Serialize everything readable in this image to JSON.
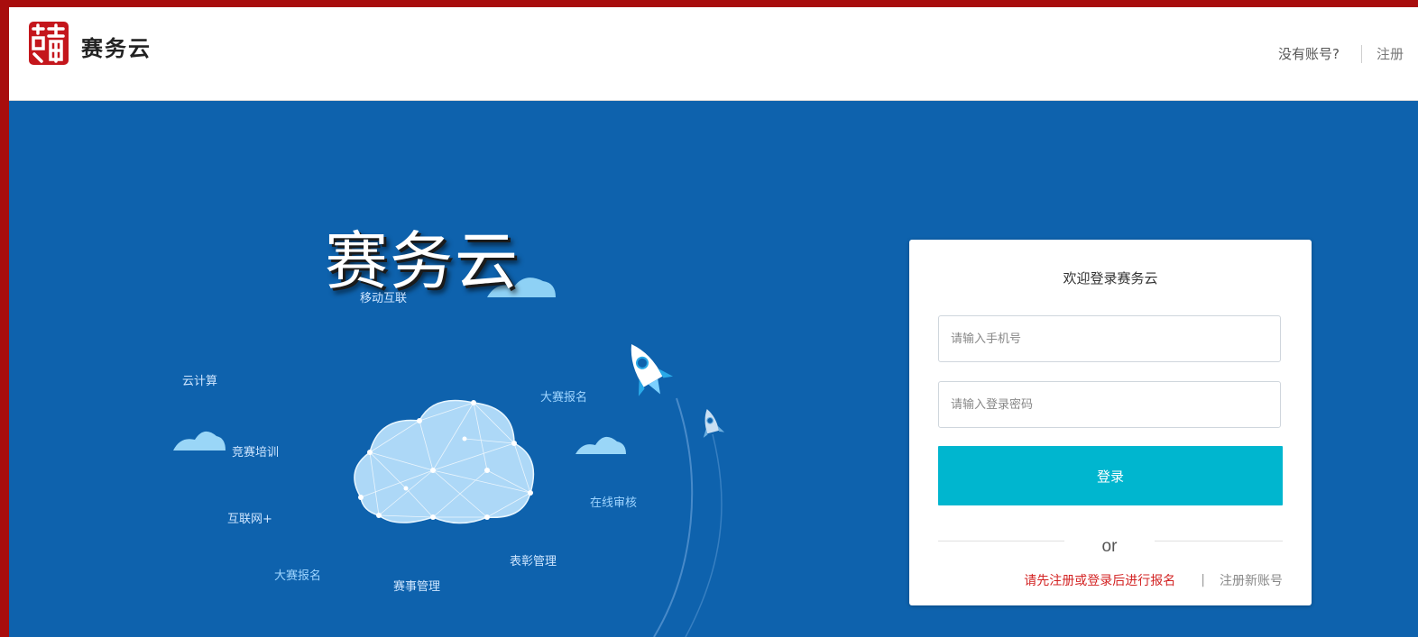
{
  "header": {
    "brand": "赛务云",
    "no_account": "没有账号?",
    "register": "注册"
  },
  "hero": {
    "title": "赛务云",
    "keywords": [
      "移动互联",
      "云计算",
      "大赛报名",
      "竞赛培训",
      "在线审核",
      "互联网+",
      "大赛报名",
      "表彰管理",
      "赛事管理"
    ]
  },
  "login": {
    "title": "欢迎登录赛务云",
    "phone_placeholder": "请输入手机号",
    "password_placeholder": "请输入登录密码",
    "login_button": "登录",
    "or": "or",
    "notice": "请先注册或登录后进行报名",
    "separator": "|",
    "new_account": "注册新账号"
  },
  "colors": {
    "frame": "#a80d0d",
    "background": "#0e62ad",
    "accent": "#00b6cf",
    "notice": "#d32323"
  }
}
